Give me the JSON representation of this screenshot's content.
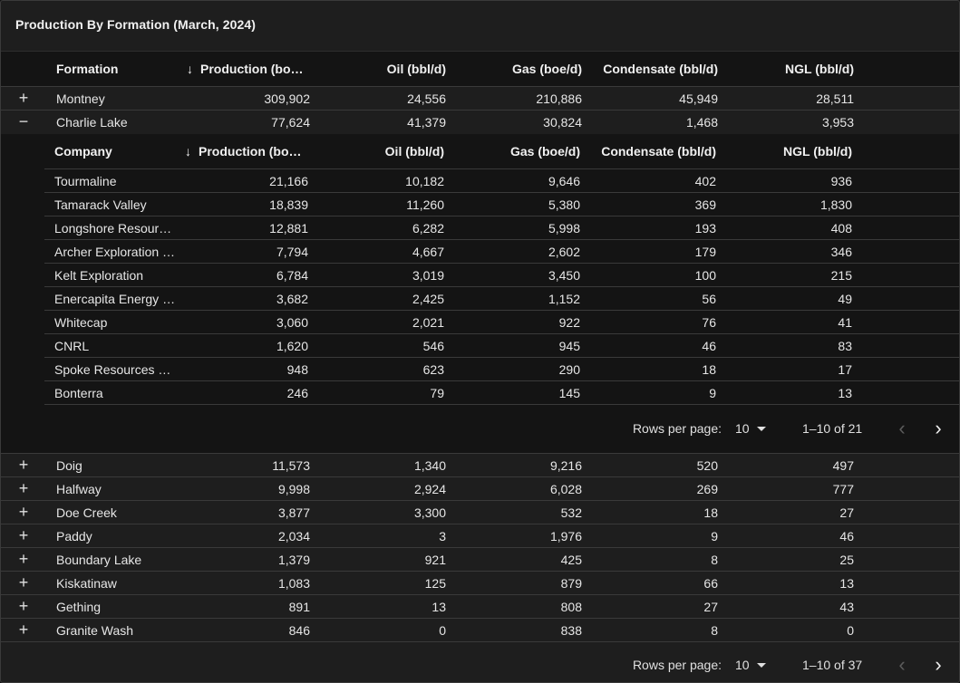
{
  "card": {
    "title": "Production By Formation (March, 2024)"
  },
  "outer": {
    "columns": [
      "Formation",
      "Production (bo…",
      "Oil (bbl/d)",
      "Gas (boe/d)",
      "Condensate (bbl/d)",
      "NGL (bbl/d)"
    ],
    "sort_icon": "arrow-down-icon",
    "rows_top": [
      {
        "toggle": "+",
        "name": "Montney",
        "production": "309,902",
        "oil": "24,556",
        "gas": "210,886",
        "condensate": "45,949",
        "ngl": "28,511"
      },
      {
        "toggle": "−",
        "name": "Charlie Lake",
        "production": "77,624",
        "oil": "41,379",
        "gas": "30,824",
        "condensate": "1,468",
        "ngl": "3,953"
      }
    ],
    "rows_bottom": [
      {
        "toggle": "+",
        "name": "Doig",
        "production": "11,573",
        "oil": "1,340",
        "gas": "9,216",
        "condensate": "520",
        "ngl": "497"
      },
      {
        "toggle": "+",
        "name": "Halfway",
        "production": "9,998",
        "oil": "2,924",
        "gas": "6,028",
        "condensate": "269",
        "ngl": "777"
      },
      {
        "toggle": "+",
        "name": "Doe Creek",
        "production": "3,877",
        "oil": "3,300",
        "gas": "532",
        "condensate": "18",
        "ngl": "27"
      },
      {
        "toggle": "+",
        "name": "Paddy",
        "production": "2,034",
        "oil": "3",
        "gas": "1,976",
        "condensate": "9",
        "ngl": "46"
      },
      {
        "toggle": "+",
        "name": "Boundary Lake",
        "production": "1,379",
        "oil": "921",
        "gas": "425",
        "condensate": "8",
        "ngl": "25"
      },
      {
        "toggle": "+",
        "name": "Kiskatinaw",
        "production": "1,083",
        "oil": "125",
        "gas": "879",
        "condensate": "66",
        "ngl": "13"
      },
      {
        "toggle": "+",
        "name": "Gething",
        "production": "891",
        "oil": "13",
        "gas": "808",
        "condensate": "27",
        "ngl": "43"
      },
      {
        "toggle": "+",
        "name": "Granite Wash",
        "production": "846",
        "oil": "0",
        "gas": "838",
        "condensate": "8",
        "ngl": "0"
      }
    ],
    "pager": {
      "rows_label": "Rows per page:",
      "rows_value": "10",
      "range": "1–10 of 37",
      "prev_icon": "chevron-left-icon",
      "next_icon": "chevron-right-icon"
    }
  },
  "inner": {
    "columns": [
      "Company",
      "Production (bo…",
      "Oil (bbl/d)",
      "Gas (boe/d)",
      "Condensate (bbl/d)",
      "NGL (bbl/d)"
    ],
    "rows": [
      {
        "name": "Tourmaline",
        "production": "21,166",
        "oil": "10,182",
        "gas": "9,646",
        "condensate": "402",
        "ngl": "936"
      },
      {
        "name": "Tamarack Valley",
        "production": "18,839",
        "oil": "11,260",
        "gas": "5,380",
        "condensate": "369",
        "ngl": "1,830"
      },
      {
        "name": "Longshore Resour…",
        "production": "12,881",
        "oil": "6,282",
        "gas": "5,998",
        "condensate": "193",
        "ngl": "408"
      },
      {
        "name": "Archer Exploration …",
        "production": "7,794",
        "oil": "4,667",
        "gas": "2,602",
        "condensate": "179",
        "ngl": "346"
      },
      {
        "name": "Kelt Exploration",
        "production": "6,784",
        "oil": "3,019",
        "gas": "3,450",
        "condensate": "100",
        "ngl": "215"
      },
      {
        "name": "Enercapita Energy …",
        "production": "3,682",
        "oil": "2,425",
        "gas": "1,152",
        "condensate": "56",
        "ngl": "49"
      },
      {
        "name": "Whitecap",
        "production": "3,060",
        "oil": "2,021",
        "gas": "922",
        "condensate": "76",
        "ngl": "41"
      },
      {
        "name": "CNRL",
        "production": "1,620",
        "oil": "546",
        "gas": "945",
        "condensate": "46",
        "ngl": "83"
      },
      {
        "name": "Spoke Resources …",
        "production": "948",
        "oil": "623",
        "gas": "290",
        "condensate": "18",
        "ngl": "17"
      },
      {
        "name": "Bonterra",
        "production": "246",
        "oil": "79",
        "gas": "145",
        "condensate": "9",
        "ngl": "13"
      }
    ],
    "pager": {
      "rows_label": "Rows per page:",
      "rows_value": "10",
      "range": "1–10 of 21",
      "prev_icon": "chevron-left-icon",
      "next_icon": "chevron-right-icon"
    }
  }
}
